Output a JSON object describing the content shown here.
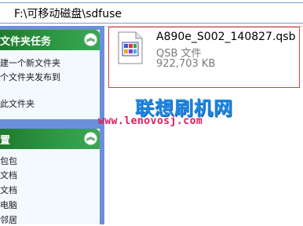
{
  "address": {
    "path": "F:\\可移动磁盘\\sdfuse"
  },
  "file_tasks": {
    "title": "文件夹任务",
    "links": [
      "建一个新文件夹",
      "个文件夹发布到",
      "此文件夹"
    ]
  },
  "other_places": {
    "title": "置",
    "links": [
      "包包",
      "文档",
      "文档",
      "电脑",
      "邻居"
    ]
  },
  "file": {
    "name": "A890e_S002_140827.qsb",
    "type": "QSB 文件",
    "size": "922,703 KB"
  },
  "watermark": {
    "title": "联想刷机网",
    "url": "www.lenovosj.com"
  },
  "colors": {
    "selection_border": "#e03c3c",
    "pane_header": "#2f9a45",
    "watermark_title": "#1e88e5",
    "watermark_url": "#e0195b"
  }
}
